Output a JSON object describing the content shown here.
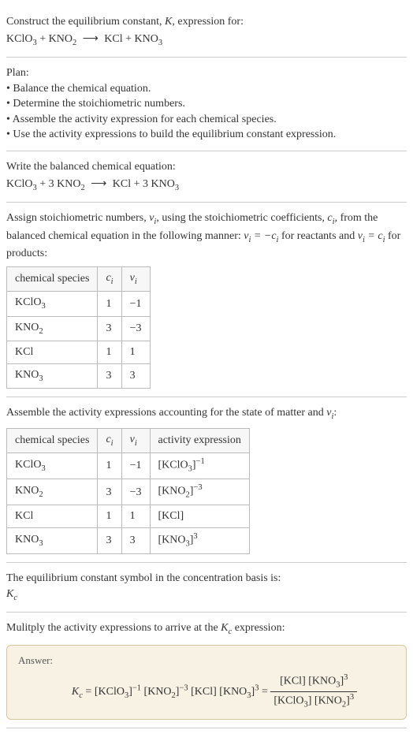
{
  "intro": {
    "line1": "Construct the equilibrium constant, ",
    "K": "K",
    "line1b": ", expression for:",
    "equation": "KClO₃ + KNO₂ ⟶ KCl + KNO₃"
  },
  "plan": {
    "header": "Plan:",
    "bullet1": "• Balance the chemical equation.",
    "bullet2": "• Determine the stoichiometric numbers.",
    "bullet3": "• Assemble the activity expression for each chemical species.",
    "bullet4": "• Use the activity expressions to build the equilibrium constant expression."
  },
  "balanced": {
    "header": "Write the balanced chemical equation:",
    "equation": "KClO₃ + 3 KNO₂ ⟶ KCl + 3 KNO₃"
  },
  "stoich": {
    "text1": "Assign stoichiometric numbers, ",
    "nu": "νᵢ",
    "text2": ", using the stoichiometric coefficients, ",
    "ci": "cᵢ",
    "text3": ", from the balanced chemical equation in the following manner: ",
    "rule1": "νᵢ = −cᵢ",
    "text4": " for reactants and ",
    "rule2": "νᵢ = cᵢ",
    "text5": " for products:",
    "headers": {
      "species": "chemical species",
      "ci": "cᵢ",
      "nu": "νᵢ"
    },
    "rows": [
      {
        "species": "KClO₃",
        "ci": "1",
        "nu": "−1"
      },
      {
        "species": "KNO₂",
        "ci": "3",
        "nu": "−3"
      },
      {
        "species": "KCl",
        "ci": "1",
        "nu": "1"
      },
      {
        "species": "KNO₃",
        "ci": "3",
        "nu": "3"
      }
    ]
  },
  "activity": {
    "header": "Assemble the activity expressions accounting for the state of matter and νᵢ:",
    "headers": {
      "species": "chemical species",
      "ci": "cᵢ",
      "nu": "νᵢ",
      "expr": "activity expression"
    },
    "rows": [
      {
        "species": "KClO₃",
        "ci": "1",
        "nu": "−1",
        "expr": "[KClO₃]⁻¹"
      },
      {
        "species": "KNO₂",
        "ci": "3",
        "nu": "−3",
        "expr": "[KNO₂]⁻³"
      },
      {
        "species": "KCl",
        "ci": "1",
        "nu": "1",
        "expr": "[KCl]"
      },
      {
        "species": "KNO₃",
        "ci": "3",
        "nu": "3",
        "expr": "[KNO₃]³"
      }
    ]
  },
  "symbol": {
    "text": "The equilibrium constant symbol in the concentration basis is:",
    "kc": "K",
    "kc_sub": "c"
  },
  "multiply": {
    "text1": "Mulitply the activity expressions to arrive at the ",
    "kc": "K",
    "kc_sub": "c",
    "text2": " expression:"
  },
  "answer": {
    "label": "Answer:",
    "lhs_k": "K",
    "lhs_c": "c",
    "eq": " = ",
    "prod": "[KClO₃]⁻¹ [KNO₂]⁻³ [KCl] [KNO₃]³",
    "eq2": " = ",
    "num": "[KCl] [KNO₃]³",
    "den": "[KClO₃] [KNO₂]³"
  }
}
